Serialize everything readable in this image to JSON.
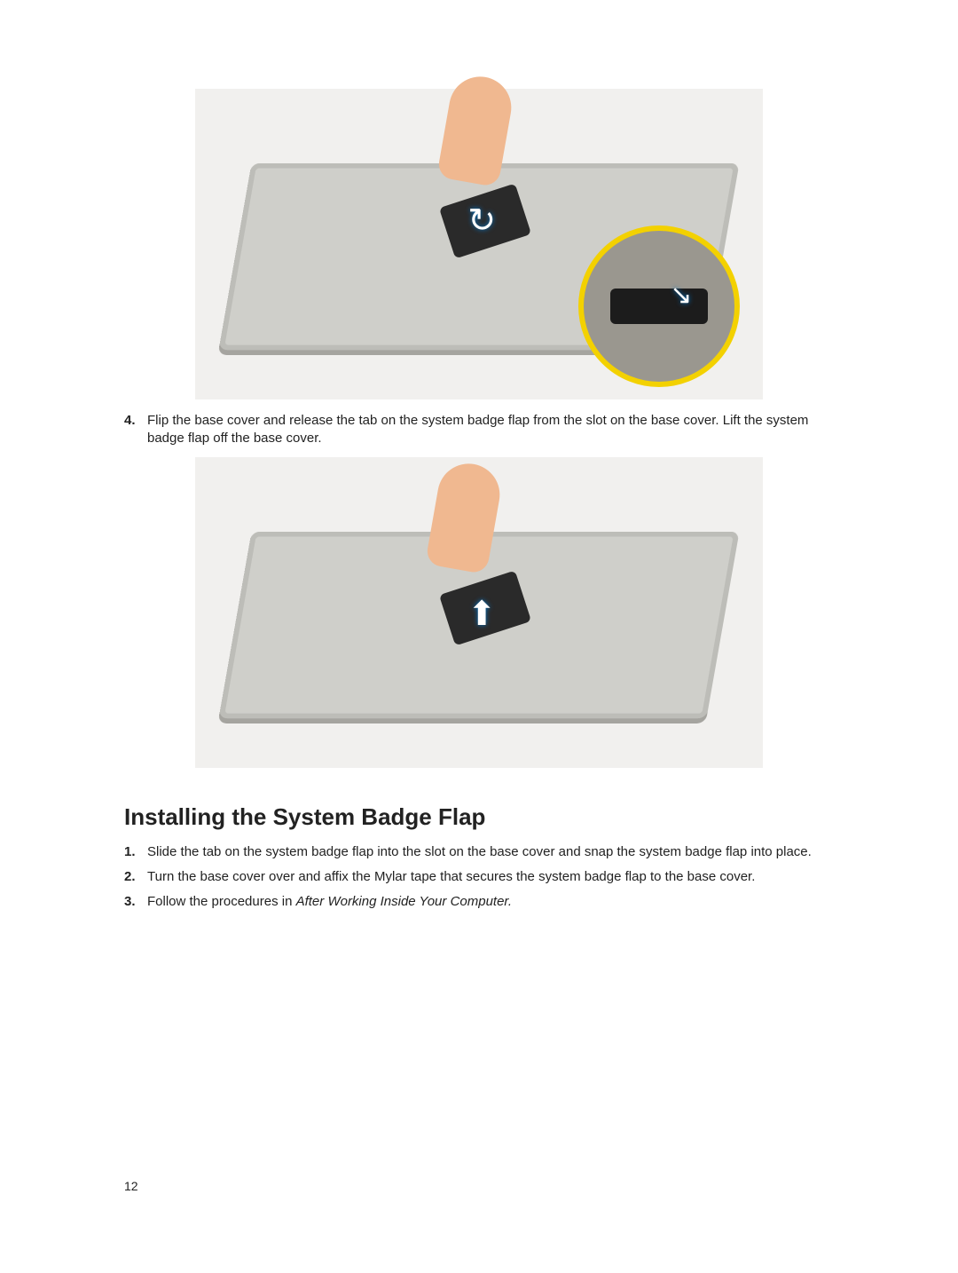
{
  "removal_step": {
    "number": "4.",
    "text": "Flip the base cover and release the tab on the system badge flap from the slot on the base cover. Lift the system badge flap off the base cover."
  },
  "section_heading": "Installing the System Badge Flap",
  "install_steps": [
    {
      "number": "1.",
      "text": "Slide the tab on the system badge flap into the slot on the base cover and snap the system badge flap into place."
    },
    {
      "number": "2.",
      "text": "Turn the base cover over and affix the Mylar tape that secures the system badge flap to the base cover."
    },
    {
      "number": "3.",
      "text_before": "Follow the procedures in ",
      "text_italic": "After Working Inside Your Computer.",
      "text_after": ""
    }
  ],
  "figure1_alt": "Hand removing system badge flap from inside of base cover with zoom inset",
  "figure2_alt": "Hand lifting system badge flap from outside of base cover",
  "page_number": "12"
}
